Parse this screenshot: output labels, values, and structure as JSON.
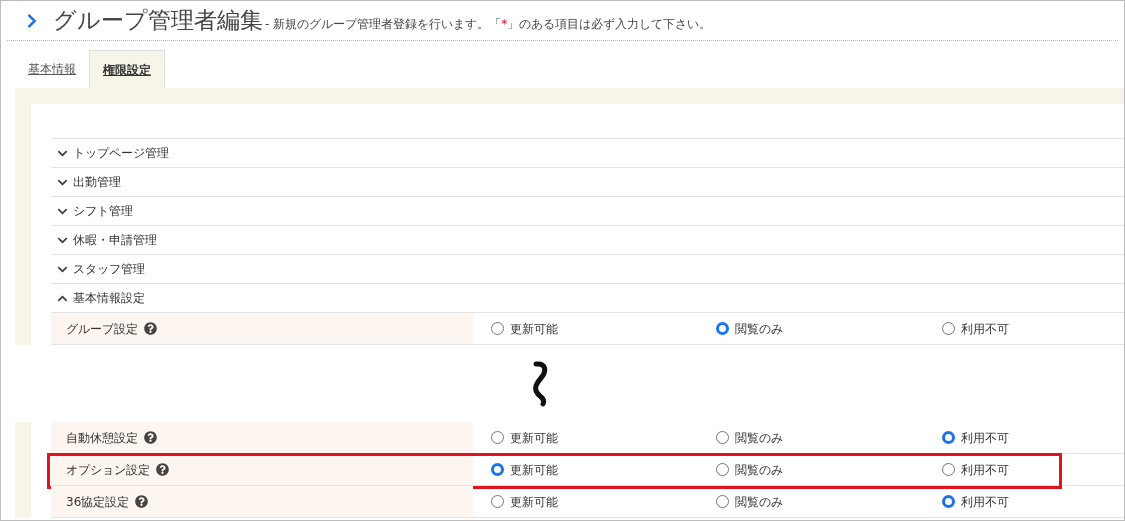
{
  "header": {
    "title": "グループ管理者編集",
    "subtitle": {
      "before": "- 新規のグループ管理者登録を行います。「",
      "mark": "*",
      "after": "」のある項目は必ず入力して下さい。"
    }
  },
  "tabs": [
    {
      "label": "基本情報",
      "selected": false
    },
    {
      "label": "権限設定",
      "selected": true
    }
  ],
  "sections": [
    {
      "label": "トップページ管理",
      "expanded": false
    },
    {
      "label": "出勤管理",
      "expanded": false
    },
    {
      "label": "シフト管理",
      "expanded": false
    },
    {
      "label": "休暇・申請管理",
      "expanded": false
    },
    {
      "label": "スタッフ管理",
      "expanded": false
    },
    {
      "label": "基本情報設定",
      "expanded": true,
      "rows": [
        {
          "kind": "setting",
          "label": "グループ設定",
          "highlighted": false,
          "options": [
            {
              "label": "更新可能",
              "selected": false
            },
            {
              "label": "閲覧のみ",
              "selected": true
            },
            {
              "label": "利用不可",
              "selected": false
            }
          ]
        },
        {
          "kind": "break"
        },
        {
          "kind": "setting",
          "label": "自動休憩設定",
          "highlighted": false,
          "options": [
            {
              "label": "更新可能",
              "selected": false
            },
            {
              "label": "閲覧のみ",
              "selected": false
            },
            {
              "label": "利用不可",
              "selected": true
            }
          ]
        },
        {
          "kind": "setting",
          "label": "オプション設定",
          "highlighted": true,
          "options": [
            {
              "label": "更新可能",
              "selected": true
            },
            {
              "label": "閲覧のみ",
              "selected": false
            },
            {
              "label": "利用不可",
              "selected": false
            }
          ]
        },
        {
          "kind": "setting",
          "label": "36協定設定",
          "highlighted": false,
          "options": [
            {
              "label": "更新可能",
              "selected": false
            },
            {
              "label": "閲覧のみ",
              "selected": false
            },
            {
              "label": "利用不可",
              "selected": true
            }
          ]
        }
      ]
    }
  ]
}
